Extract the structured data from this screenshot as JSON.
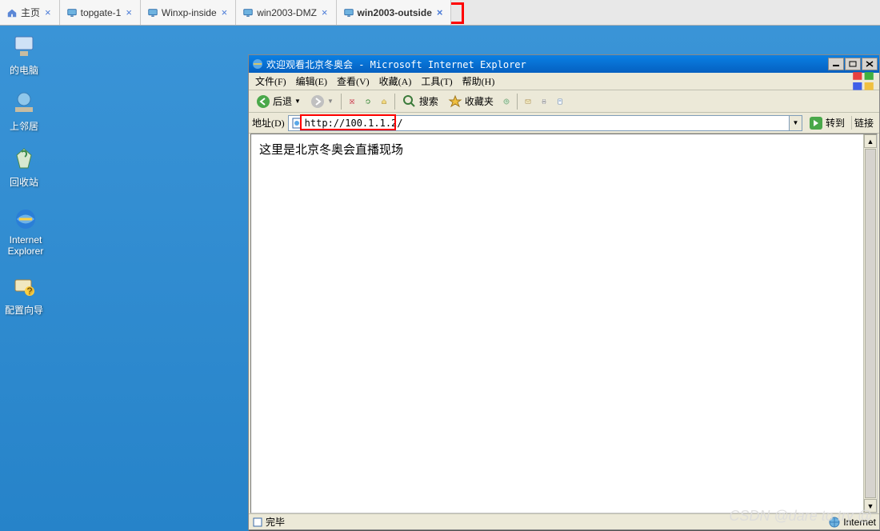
{
  "vm_tabs": {
    "home_label": "主页",
    "items": [
      {
        "label": "topgate-1"
      },
      {
        "label": "Winxp-inside"
      },
      {
        "label": "win2003-DMZ"
      },
      {
        "label": "win2003-outside"
      }
    ]
  },
  "desktop_icons": {
    "computer": "的电脑",
    "network": "上邻居",
    "recycle": "回收站",
    "ie": "Internet Explorer",
    "wizard": "配置向导"
  },
  "ie": {
    "title": "欢迎观看北京冬奥会 - Microsoft Internet Explorer",
    "menus": {
      "file": "文件(F)",
      "edit": "编辑(E)",
      "view": "查看(V)",
      "favorites": "收藏(A)",
      "tools": "工具(T)",
      "help": "帮助(H)"
    },
    "toolbar": {
      "back": "后退",
      "search": "搜索",
      "favorites": "收藏夹"
    },
    "addressbar": {
      "label": "地址(D)",
      "url": "http://100.1.1.2/",
      "go": "转到",
      "links": "链接"
    },
    "page_body": "这里是北京冬奥会直播现场",
    "status": {
      "left": "完毕",
      "zone": "Internet"
    }
  },
  "watermark": "CSDN @dare to try @"
}
